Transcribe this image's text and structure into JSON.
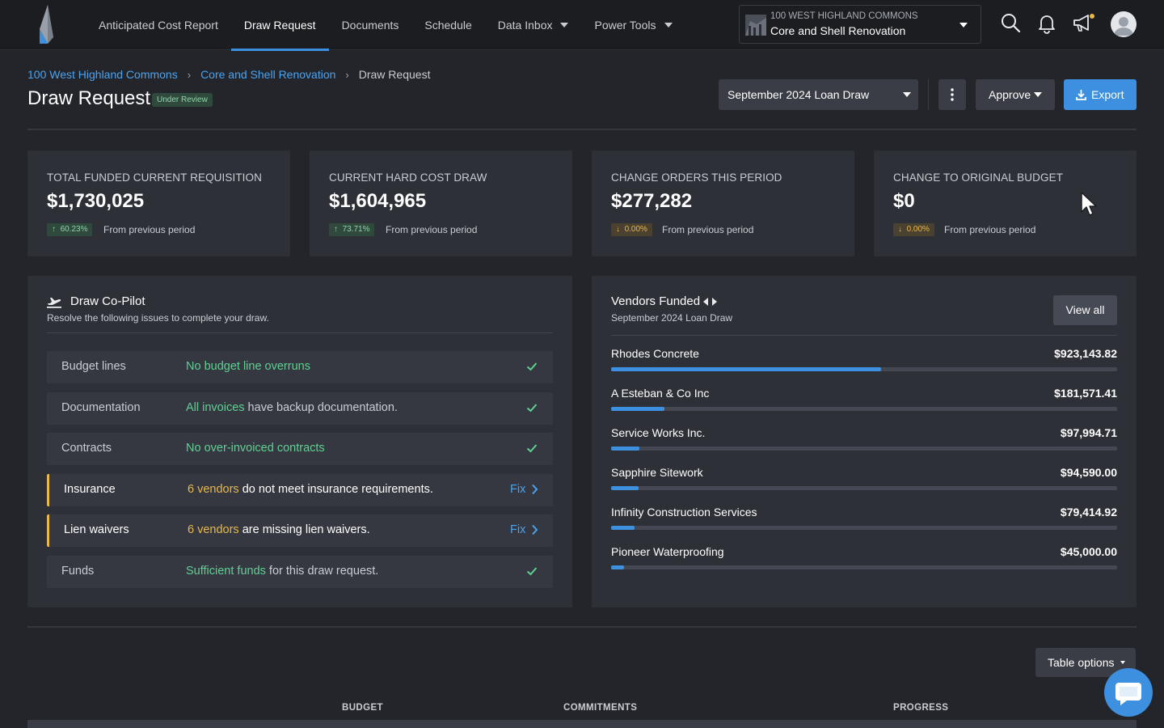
{
  "nav": {
    "items": [
      {
        "label": "Anticipated Cost Report",
        "active": false,
        "has_dropdown": false
      },
      {
        "label": "Draw Request",
        "active": true,
        "has_dropdown": false
      },
      {
        "label": "Documents",
        "active": false,
        "has_dropdown": false
      },
      {
        "label": "Schedule",
        "active": false,
        "has_dropdown": false
      },
      {
        "label": "Data Inbox",
        "active": false,
        "has_dropdown": true
      },
      {
        "label": "Power Tools",
        "active": false,
        "has_dropdown": true
      }
    ],
    "project_selector": {
      "subtitle": "100 WEST HIGHLAND COMMONS",
      "title": "Core and Shell Renovation"
    },
    "icons": [
      "search-icon",
      "bell-icon",
      "megaphone-icon",
      "avatar"
    ]
  },
  "breadcrumb": {
    "items": [
      "100 West Highland Commons",
      "Core and Shell Renovation"
    ],
    "current": "Draw Request"
  },
  "page": {
    "title": "Draw Request",
    "status": "Under Review"
  },
  "actions": {
    "draw_select": "September 2024 Loan Draw",
    "approve": "Approve",
    "export": "Export"
  },
  "stats": [
    {
      "label": "TOTAL FUNDED CURRENT REQUISITION",
      "value": "$1,730,025",
      "change": "60.23%",
      "direction": "up",
      "note": "From previous period"
    },
    {
      "label": "CURRENT HARD COST DRAW",
      "value": "$1,604,965",
      "change": "73.71%",
      "direction": "up",
      "note": "From previous period"
    },
    {
      "label": "CHANGE ORDERS THIS PERIOD",
      "value": "$277,282",
      "change": "0.00%",
      "direction": "down",
      "note": "From previous period"
    },
    {
      "label": "CHANGE TO ORIGINAL BUDGET",
      "value": "$0",
      "change": "0.00%",
      "direction": "down",
      "note": "From previous period"
    }
  ],
  "copilot": {
    "title": "Draw Co-Pilot",
    "subtitle": "Resolve the following issues to complete your draw.",
    "fix_label": "Fix",
    "issues": [
      {
        "name": "Budget lines",
        "highlight": "No budget line overruns",
        "rest": "",
        "status": "ok"
      },
      {
        "name": "Documentation",
        "highlight": "All invoices",
        "rest": " have backup documentation.",
        "status": "ok"
      },
      {
        "name": "Contracts",
        "highlight": "No over-invoiced contracts",
        "rest": "",
        "status": "ok"
      },
      {
        "name": "Insurance",
        "highlight": "6 vendors",
        "rest": " do not meet insurance requirements.",
        "status": "warn"
      },
      {
        "name": "Lien waivers",
        "highlight": "6 vendors",
        "rest": " are missing lien waivers.",
        "status": "warn"
      },
      {
        "name": "Funds",
        "highlight": "Sufficient funds",
        "rest": " for this draw request.",
        "status": "ok"
      }
    ]
  },
  "vendors": {
    "title": "Vendors Funded",
    "subtitle": "September 2024 Loan Draw",
    "view_all": "View all",
    "items": [
      {
        "name": "Rhodes Concrete",
        "amount": "$923,143.82",
        "value": 923143.82
      },
      {
        "name": "A Esteban & Co Inc",
        "amount": "$181,571.41",
        "value": 181571.41
      },
      {
        "name": "Service Works Inc.",
        "amount": "$97,994.71",
        "value": 97994.71
      },
      {
        "name": "Sapphire Sitework",
        "amount": "$94,590.00",
        "value": 94590.0
      },
      {
        "name": "Infinity Construction Services",
        "amount": "$79,414.92",
        "value": 79414.92
      },
      {
        "name": "Pioneer Waterproofing",
        "amount": "$45,000.00",
        "value": 45000.0
      }
    ],
    "bar_max": 1730025
  },
  "table": {
    "options_label": "Table options",
    "headers": [
      "BUDGET",
      "COMMITMENTS",
      "PROGRESS"
    ]
  },
  "colors": {
    "accent": "#3d8fe0",
    "ok": "#5fd092",
    "warn": "#e8b84b",
    "background": "#23252b",
    "card": "#2e3037"
  }
}
